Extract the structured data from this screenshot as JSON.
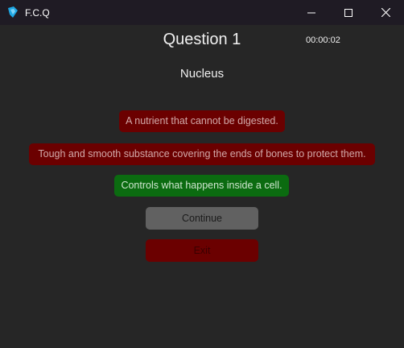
{
  "window": {
    "title": "F.C.Q",
    "icon": "app-logo-icon",
    "controls": [
      "minimize-icon",
      "maximize-icon",
      "close-icon"
    ]
  },
  "quiz": {
    "question_title": "Question 1",
    "timer": "00:00:02",
    "term": "Nucleus",
    "answers": [
      {
        "text": "A nutrient that cannot be digested.",
        "status": "wrong"
      },
      {
        "text": "Tough and smooth substance covering the ends of bones to protect them.",
        "status": "wrong"
      },
      {
        "text": "Controls what happens inside a cell.",
        "status": "correct"
      }
    ],
    "continue_label": "Continue",
    "exit_label": "Exit"
  },
  "colors": {
    "background": "#262626",
    "titlebar": "#1f1b24",
    "wrong": "#6b0000",
    "correct": "#0b6b10",
    "continue_button": "#616161",
    "accent_icon": "#1ea7e4"
  }
}
